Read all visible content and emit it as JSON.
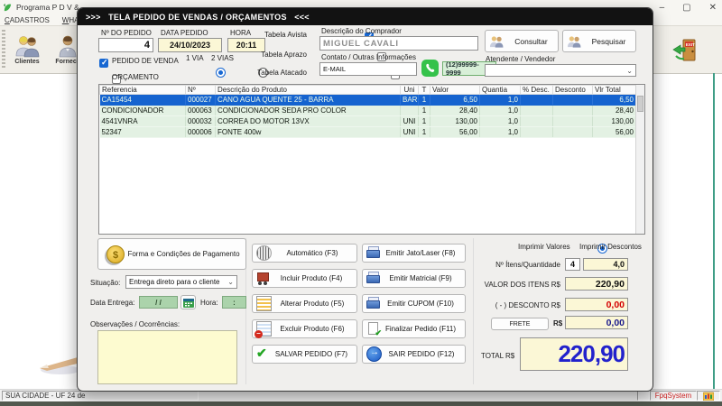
{
  "window": {
    "title": "Programa P D V &",
    "menu": [
      "CADASTROS",
      "WHATS"
    ],
    "toolbar": {
      "clientes": "Clientes",
      "fornecedores": "Fornece"
    },
    "controls": {
      "minimize": "–",
      "maximize": "▢",
      "close": "✕"
    },
    "status_left": "SUA CIDADE - UF 24 de",
    "status_brand": "FpqSystem"
  },
  "dialog": {
    "title": ">>>   TELA PEDIDO DE VENDAS / ORÇAMENTOS   <<<",
    "order": {
      "numero_label": "Nº DO PEDIDO",
      "numero": "4",
      "data_label": "DATA PEDIDO",
      "data": "24/10/2023",
      "hora_label": "HORA",
      "hora": "20:11",
      "pedido_venda_label": "PEDIDO DE VENDA",
      "orcamento_label": "ORÇAMENTO",
      "via1_label": "1 VIA",
      "via2_label": "2 VIAS",
      "tabela_avista_label": "Tabela Avista",
      "tabela_aprazo_label": "Tabela Aprazo",
      "tabela_atacado_label": "Tabela Atacado"
    },
    "buyer": {
      "comprador_label": "Descrição do Comprador",
      "comprador": "MIGUEL CAVALI",
      "contato_label": "Contato / Outras Informações",
      "email": "E-MAIL",
      "phone": "(12)99999-9999",
      "consultar_label": "Consultar",
      "pesquisar_label": "Pesquisar",
      "atendente_label": "Atendente / Vendedor"
    },
    "table": {
      "columns": [
        "Referencia",
        "Nº",
        "Descrição do Produto",
        "Uni",
        "T",
        "Valor",
        "Quantia",
        "% Desc.",
        "Desconto",
        "Vlr Total"
      ],
      "rows": [
        {
          "selected": true,
          "cells": [
            "CA15454",
            "000027",
            "CANO AGUA QUENTE 25 - BARRA",
            "BAR",
            "1",
            "6,50",
            "1,0",
            "",
            "",
            "6,50"
          ]
        },
        {
          "selected": false,
          "cells": [
            "CONDICIONADOR",
            "000063",
            "CONDICIONADOR SEDA PRO COLOR",
            "",
            "1",
            "28,40",
            "1,0",
            "",
            "",
            "28,40"
          ]
        },
        {
          "selected": false,
          "cells": [
            "4541VNRA",
            "000032",
            "CORREA DO MOTOR 13VX",
            "UNI",
            "1",
            "130,00",
            "1,0",
            "",
            "",
            "130,00"
          ]
        },
        {
          "selected": false,
          "cells": [
            "52347",
            "000006",
            "FONTE 400w",
            "UNI",
            "1",
            "56,00",
            "1,0",
            "",
            "",
            "56,00"
          ]
        }
      ]
    },
    "left_panel": {
      "payment_button": "Forma e Condições de Pagamento",
      "situacao_label": "Situação:",
      "situacao_value": "Entrega direto para o cliente",
      "data_entrega_label": "Data Entrega:",
      "data_entrega_value": "/ /",
      "hora_label": "Hora:",
      "hora_value": ":",
      "observacoes_label": "Observações / Ocorrências:"
    },
    "actions": {
      "left": [
        {
          "name": "automatico-f3-button",
          "icon": "barcode",
          "label": "Automático   (F3)"
        },
        {
          "name": "incluir-produto-f4-button",
          "icon": "cart",
          "label": "Incluir Produto  (F4)"
        },
        {
          "name": "alterar-produto-f5-button",
          "icon": "sheet",
          "label": "Alterar Produto  (F5)"
        },
        {
          "name": "excluir-produto-f6-button",
          "icon": "sheet2",
          "label": "Excluir Produto  (F6)"
        },
        {
          "name": "salvar-pedido-f7-button",
          "icon": "check",
          "label": "SALVAR PEDIDO (F7)"
        }
      ],
      "right": [
        {
          "name": "emitir-jato-laser-f8-button",
          "icon": "printer",
          "label": "Emitir Jato/Laser (F8)"
        },
        {
          "name": "emitir-matricial-f9-button",
          "icon": "printer",
          "label": "Emitir Matricial  (F9)"
        },
        {
          "name": "emitir-cupom-f10-button",
          "icon": "printer",
          "label": "Emitir CUPOM  (F10)"
        },
        {
          "name": "finalizar-pedido-f11-button",
          "icon": "doccheck",
          "label": "Finalizar Pedido  (F11)"
        },
        {
          "name": "sair-pedido-f12-button",
          "icon": "exit",
          "label": "SAIR  PEDIDO  (F12)"
        }
      ]
    },
    "totals": {
      "imprimir_valores_label": "Imprimir Valores",
      "imprimir_descontos_label": "Imprimir Descontos",
      "itens_label": "Nº Ítens/Quantidade",
      "itens_count": "4",
      "itens_qty": "4,0",
      "valor_label": "VALOR DOS ITENS R$",
      "valor": "220,90",
      "desconto_label": "( - ) DESCONTO R$",
      "desconto": "0,00",
      "frete_button": "FRETE",
      "frete_currency": "R$",
      "frete": "0,00",
      "total_label": "TOTAL R$",
      "total": "220,90"
    },
    "colors": {
      "accent_blue": "#1767d2",
      "selected_row": "#1563cf",
      "field_cream": "#fbf7d6",
      "field_green": "#abd3ab",
      "desconto_red": "#d40000",
      "total_blue": "#2222cc",
      "whatsapp_green": "#35c24b"
    }
  }
}
